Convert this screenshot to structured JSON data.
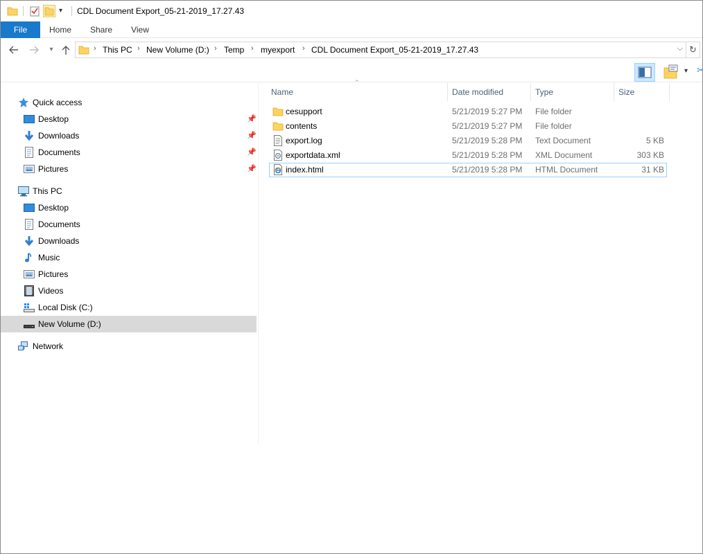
{
  "window": {
    "title": "CDL Document Export_05-21-2019_17.27.43"
  },
  "ribbon": {
    "tabs": [
      {
        "label": "File"
      },
      {
        "label": "Home"
      },
      {
        "label": "Share"
      },
      {
        "label": "View"
      }
    ]
  },
  "address": {
    "crumbs": [
      "This PC",
      "New Volume (D:)",
      "Temp",
      "myexport",
      "CDL Document Export_05-21-2019_17.27.43"
    ]
  },
  "navpane": {
    "quick_access": {
      "label": "Quick access",
      "items": [
        {
          "label": "Desktop",
          "icon": "desktop-icon"
        },
        {
          "label": "Downloads",
          "icon": "downloads-icon"
        },
        {
          "label": "Documents",
          "icon": "documents-icon"
        },
        {
          "label": "Pictures",
          "icon": "pictures-icon"
        }
      ]
    },
    "this_pc": {
      "label": "This PC",
      "items": [
        {
          "label": "Desktop",
          "icon": "desktop-icon"
        },
        {
          "label": "Documents",
          "icon": "documents-icon"
        },
        {
          "label": "Downloads",
          "icon": "downloads-icon"
        },
        {
          "label": "Music",
          "icon": "music-icon"
        },
        {
          "label": "Pictures",
          "icon": "pictures-icon"
        },
        {
          "label": "Videos",
          "icon": "videos-icon"
        },
        {
          "label": "Local Disk (C:)",
          "icon": "local-disk-icon"
        },
        {
          "label": "New Volume (D:)",
          "icon": "drive-icon",
          "selected": true
        }
      ]
    },
    "network": {
      "label": "Network"
    }
  },
  "filelist": {
    "columns": {
      "name": "Name",
      "date": "Date modified",
      "type": "Type",
      "size": "Size"
    },
    "rows": [
      {
        "name": "cesupport",
        "date": "5/21/2019 5:27 PM",
        "type": "File folder",
        "size": "",
        "icon": "folder-icon"
      },
      {
        "name": "contents",
        "date": "5/21/2019 5:27 PM",
        "type": "File folder",
        "size": "",
        "icon": "folder-icon"
      },
      {
        "name": "export.log",
        "date": "5/21/2019 5:28 PM",
        "type": "Text Document",
        "size": "5 KB",
        "icon": "text-file-icon"
      },
      {
        "name": "exportdata.xml",
        "date": "5/21/2019 5:28 PM",
        "type": "XML Document",
        "size": "303 KB",
        "icon": "xml-file-icon"
      },
      {
        "name": "index.html",
        "date": "5/21/2019 5:28 PM",
        "type": "HTML Document",
        "size": "31 KB",
        "icon": "ie-html-icon",
        "focused": true
      }
    ]
  },
  "colors": {
    "file_tab": "#1979ca",
    "folder": "#ffd35e",
    "selection": "#d9d9d9",
    "header_text": "#4c607a"
  }
}
